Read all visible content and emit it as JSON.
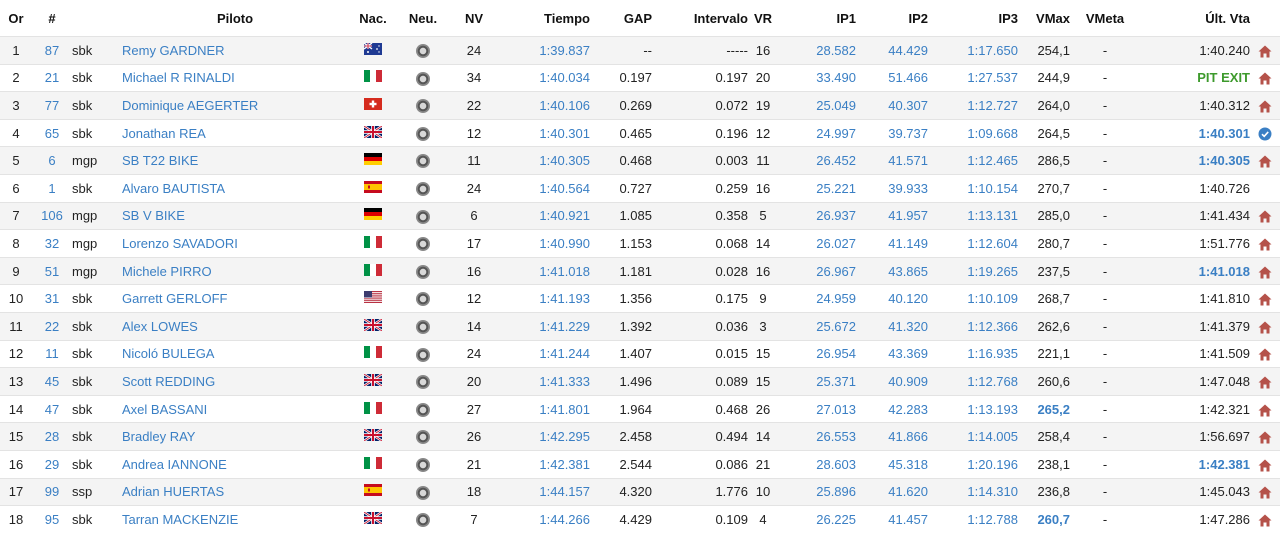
{
  "headers": {
    "or": "Or",
    "num": "#",
    "piloto": "Piloto",
    "nac": "Nac.",
    "neu": "Neu.",
    "nv": "NV",
    "tiempo": "Tiempo",
    "gap": "GAP",
    "intervalo": "Intervalo",
    "vr": "VR",
    "ip1": "IP1",
    "ip2": "IP2",
    "ip3": "IP3",
    "vmax": "VMax",
    "vmeta": "VMeta",
    "ultvta": "Últ. Vta"
  },
  "colors": {
    "link": "#3a7fc4",
    "pit": "#3d9a2c",
    "home": "#b5524a",
    "stripe": "#f4f4f4"
  },
  "rows": [
    {
      "or": "1",
      "num": "87",
      "cls": "sbk",
      "name": "Remy GARDNER",
      "flag": "aus",
      "nv": "24",
      "tiempo": "1:39.837",
      "gap": "--",
      "intervalo": "-----",
      "vr": "16",
      "ip1": "28.582",
      "ip2": "44.429",
      "ip3": "1:17.650",
      "vmax": "254,1",
      "vmax_best": false,
      "vmeta": "-",
      "ult": "1:40.240",
      "ult_style": "normal",
      "icon": "home-icon"
    },
    {
      "or": "2",
      "num": "21",
      "cls": "sbk",
      "name": "Michael R RINALDI",
      "flag": "ita",
      "nv": "34",
      "tiempo": "1:40.034",
      "gap": "0.197",
      "intervalo": "0.197",
      "vr": "20",
      "ip1": "33.490",
      "ip2": "51.466",
      "ip3": "1:27.537",
      "vmax": "244,9",
      "vmax_best": false,
      "vmeta": "-",
      "ult": "PIT EXIT",
      "ult_style": "pit",
      "icon": "home-icon"
    },
    {
      "or": "3",
      "num": "77",
      "cls": "sbk",
      "name": "Dominique AEGERTER",
      "flag": "sui",
      "nv": "22",
      "tiempo": "1:40.106",
      "gap": "0.269",
      "intervalo": "0.072",
      "vr": "19",
      "ip1": "25.049",
      "ip2": "40.307",
      "ip3": "1:12.727",
      "vmax": "264,0",
      "vmax_best": false,
      "vmeta": "-",
      "ult": "1:40.312",
      "ult_style": "normal",
      "icon": "home-icon"
    },
    {
      "or": "4",
      "num": "65",
      "cls": "sbk",
      "name": "Jonathan REA",
      "flag": "gbr",
      "nv": "12",
      "tiempo": "1:40.301",
      "gap": "0.465",
      "intervalo": "0.196",
      "vr": "12",
      "ip1": "24.997",
      "ip2": "39.737",
      "ip3": "1:09.668",
      "vmax": "264,5",
      "vmax_best": false,
      "vmeta": "-",
      "ult": "1:40.301",
      "ult_style": "best",
      "icon": "check-circle-icon"
    },
    {
      "or": "5",
      "num": "6",
      "cls": "mgp",
      "name": "SB T22 BIKE",
      "flag": "ger",
      "nv": "11",
      "tiempo": "1:40.305",
      "gap": "0.468",
      "intervalo": "0.003",
      "vr": "11",
      "ip1": "26.452",
      "ip2": "41.571",
      "ip3": "1:12.465",
      "vmax": "286,5",
      "vmax_best": false,
      "vmeta": "-",
      "ult": "1:40.305",
      "ult_style": "best",
      "icon": "home-icon"
    },
    {
      "or": "6",
      "num": "1",
      "cls": "sbk",
      "name": "Alvaro BAUTISTA",
      "flag": "esp",
      "nv": "24",
      "tiempo": "1:40.564",
      "gap": "0.727",
      "intervalo": "0.259",
      "vr": "16",
      "ip1": "25.221",
      "ip2": "39.933",
      "ip3": "1:10.154",
      "vmax": "270,7",
      "vmax_best": false,
      "vmeta": "-",
      "ult": "1:40.726",
      "ult_style": "normal",
      "icon": ""
    },
    {
      "or": "7",
      "num": "106",
      "cls": "mgp",
      "name": "SB V BIKE",
      "flag": "ger",
      "nv": "6",
      "tiempo": "1:40.921",
      "gap": "1.085",
      "intervalo": "0.358",
      "vr": "5",
      "ip1": "26.937",
      "ip2": "41.957",
      "ip3": "1:13.131",
      "vmax": "285,0",
      "vmax_best": false,
      "vmeta": "-",
      "ult": "1:41.434",
      "ult_style": "normal",
      "icon": "home-icon"
    },
    {
      "or": "8",
      "num": "32",
      "cls": "mgp",
      "name": "Lorenzo SAVADORI",
      "flag": "ita",
      "nv": "17",
      "tiempo": "1:40.990",
      "gap": "1.153",
      "intervalo": "0.068",
      "vr": "14",
      "ip1": "26.027",
      "ip2": "41.149",
      "ip3": "1:12.604",
      "vmax": "280,7",
      "vmax_best": false,
      "vmeta": "-",
      "ult": "1:51.776",
      "ult_style": "normal",
      "icon": "home-icon"
    },
    {
      "or": "9",
      "num": "51",
      "cls": "mgp",
      "name": "Michele PIRRO",
      "flag": "ita",
      "nv": "16",
      "tiempo": "1:41.018",
      "gap": "1.181",
      "intervalo": "0.028",
      "vr": "16",
      "ip1": "26.967",
      "ip2": "43.865",
      "ip3": "1:19.265",
      "vmax": "237,5",
      "vmax_best": false,
      "vmeta": "-",
      "ult": "1:41.018",
      "ult_style": "best",
      "icon": "home-icon"
    },
    {
      "or": "10",
      "num": "31",
      "cls": "sbk",
      "name": "Garrett GERLOFF",
      "flag": "usa",
      "nv": "12",
      "tiempo": "1:41.193",
      "gap": "1.356",
      "intervalo": "0.175",
      "vr": "9",
      "ip1": "24.959",
      "ip2": "40.120",
      "ip3": "1:10.109",
      "vmax": "268,7",
      "vmax_best": false,
      "vmeta": "-",
      "ult": "1:41.810",
      "ult_style": "normal",
      "icon": "home-icon"
    },
    {
      "or": "11",
      "num": "22",
      "cls": "sbk",
      "name": "Alex LOWES",
      "flag": "gbr",
      "nv": "14",
      "tiempo": "1:41.229",
      "gap": "1.392",
      "intervalo": "0.036",
      "vr": "3",
      "ip1": "25.672",
      "ip2": "41.320",
      "ip3": "1:12.366",
      "vmax": "262,6",
      "vmax_best": false,
      "vmeta": "-",
      "ult": "1:41.379",
      "ult_style": "normal",
      "icon": "home-icon"
    },
    {
      "or": "12",
      "num": "11",
      "cls": "sbk",
      "name": "Nicoló BULEGA",
      "flag": "ita",
      "nv": "24",
      "tiempo": "1:41.244",
      "gap": "1.407",
      "intervalo": "0.015",
      "vr": "15",
      "ip1": "26.954",
      "ip2": "43.369",
      "ip3": "1:16.935",
      "vmax": "221,1",
      "vmax_best": false,
      "vmeta": "-",
      "ult": "1:41.509",
      "ult_style": "normal",
      "icon": "home-icon"
    },
    {
      "or": "13",
      "num": "45",
      "cls": "sbk",
      "name": "Scott REDDING",
      "flag": "gbr",
      "nv": "20",
      "tiempo": "1:41.333",
      "gap": "1.496",
      "intervalo": "0.089",
      "vr": "15",
      "ip1": "25.371",
      "ip2": "40.909",
      "ip3": "1:12.768",
      "vmax": "260,6",
      "vmax_best": false,
      "vmeta": "-",
      "ult": "1:47.048",
      "ult_style": "normal",
      "icon": "home-icon"
    },
    {
      "or": "14",
      "num": "47",
      "cls": "sbk",
      "name": "Axel BASSANI",
      "flag": "ita",
      "nv": "27",
      "tiempo": "1:41.801",
      "gap": "1.964",
      "intervalo": "0.468",
      "vr": "26",
      "ip1": "27.013",
      "ip2": "42.283",
      "ip3": "1:13.193",
      "vmax": "265,2",
      "vmax_best": true,
      "vmeta": "-",
      "ult": "1:42.321",
      "ult_style": "normal",
      "icon": "home-icon"
    },
    {
      "or": "15",
      "num": "28",
      "cls": "sbk",
      "name": "Bradley RAY",
      "flag": "gbr",
      "nv": "26",
      "tiempo": "1:42.295",
      "gap": "2.458",
      "intervalo": "0.494",
      "vr": "14",
      "ip1": "26.553",
      "ip2": "41.866",
      "ip3": "1:14.005",
      "vmax": "258,4",
      "vmax_best": false,
      "vmeta": "-",
      "ult": "1:56.697",
      "ult_style": "normal",
      "icon": "home-icon"
    },
    {
      "or": "16",
      "num": "29",
      "cls": "sbk",
      "name": "Andrea IANNONE",
      "flag": "ita",
      "nv": "21",
      "tiempo": "1:42.381",
      "gap": "2.544",
      "intervalo": "0.086",
      "vr": "21",
      "ip1": "28.603",
      "ip2": "45.318",
      "ip3": "1:20.196",
      "vmax": "238,1",
      "vmax_best": false,
      "vmeta": "-",
      "ult": "1:42.381",
      "ult_style": "best",
      "icon": "home-icon"
    },
    {
      "or": "17",
      "num": "99",
      "cls": "ssp",
      "name": "Adrian HUERTAS",
      "flag": "esp",
      "nv": "18",
      "tiempo": "1:44.157",
      "gap": "4.320",
      "intervalo": "1.776",
      "vr": "10",
      "ip1": "25.896",
      "ip2": "41.620",
      "ip3": "1:14.310",
      "vmax": "236,8",
      "vmax_best": false,
      "vmeta": "-",
      "ult": "1:45.043",
      "ult_style": "normal",
      "icon": "home-icon"
    },
    {
      "or": "18",
      "num": "95",
      "cls": "sbk",
      "name": "Tarran MACKENZIE",
      "flag": "gbr",
      "nv": "7",
      "tiempo": "1:44.266",
      "gap": "4.429",
      "intervalo": "0.109",
      "vr": "4",
      "ip1": "26.225",
      "ip2": "41.457",
      "ip3": "1:12.788",
      "vmax": "260,7",
      "vmax_best": true,
      "vmeta": "-",
      "ult": "1:47.286",
      "ult_style": "normal",
      "icon": "home-icon"
    }
  ]
}
